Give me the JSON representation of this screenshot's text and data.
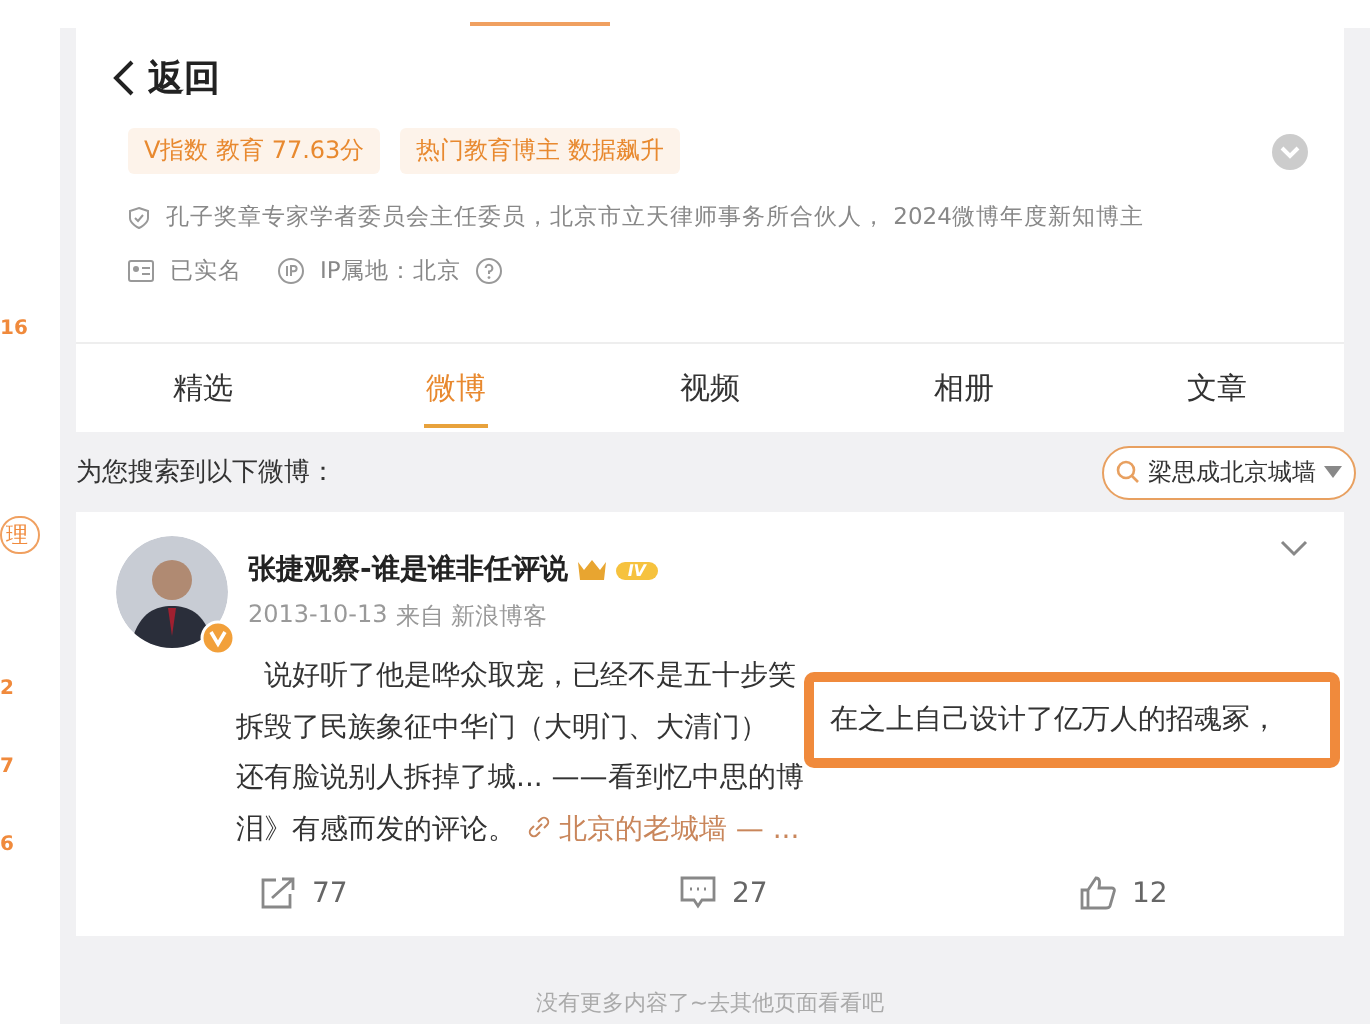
{
  "sidebar": {
    "items": [
      {
        "text": "16",
        "kind": "count"
      },
      {
        "text": "理",
        "kind": "tag"
      },
      {
        "text": "2",
        "kind": "count"
      },
      {
        "text": "7",
        "kind": "count"
      },
      {
        "text": "6",
        "kind": "count"
      }
    ]
  },
  "profile": {
    "back": "返回",
    "tags": [
      "V指数 教育 77.63分",
      "热门教育博主 数据飙升"
    ],
    "bio": "孔子奖章专家学者委员会主任委员，北京市立天律师事务所合伙人， 2024微博年度新知博主",
    "verified": "已实名",
    "ip": "IP属地：北京"
  },
  "tabs": [
    {
      "label": "精选",
      "selected": false
    },
    {
      "label": "微博",
      "selected": true
    },
    {
      "label": "视频",
      "selected": false
    },
    {
      "label": "相册",
      "selected": false
    },
    {
      "label": "文章",
      "selected": false
    }
  ],
  "search_result": {
    "label": "为您搜索到以下微博：",
    "query": "梁思成北京城墙"
  },
  "post": {
    "author": "张捷观察-谁是谁非任评说",
    "badge": "IV",
    "date": "2013-10-13",
    "source": "来自 新浪博客",
    "lines": [
      "说好听了他是哗众取宠，已经不是五十步笑",
      "拆毁了民族象征中华门（大明门、大清门）",
      "还有脸说别人拆掉了城... ——看到忆中思的博",
      "泪》有感而发的评论。"
    ],
    "link": "北京的老城墙 —",
    "ellipsis": "...",
    "highlight": "在之上自己设计了亿万人的招魂冢，",
    "reposts": "77",
    "comments": "27",
    "likes": "12"
  },
  "footer": "没有更多内容了~去其他页面看看吧"
}
